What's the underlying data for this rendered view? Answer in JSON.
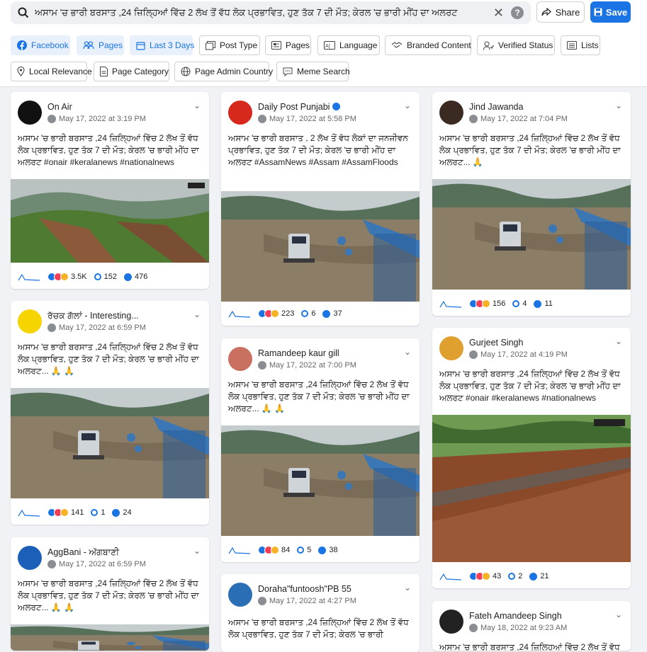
{
  "search": {
    "query": "ਅਸਾਮ 'ਚ ਭਾਰੀ ਬਰਸਾਤ ,24 ਜ਼ਿਲ੍ਹਿਆਂ ਵਿੱਚ 2 ਲੱਖ ਤੋਂ ਵੱਧ ਲੋਕ ਪ੍ਰਭਾਵਿਤ, ਹੁਣ ਤੱਕ 7 ਦੀ ਮੌਤ; ਕੇਰਲ 'ਚ ਭਾਰੀ ਮੀਂਹ ਦਾ ਅਲਰਟ",
    "help": "?"
  },
  "actions": {
    "share": "Share",
    "save": "Save"
  },
  "filters": [
    {
      "label": "Facebook",
      "icon": "facebook-icon",
      "active": true
    },
    {
      "label": "Pages",
      "icon": "people-icon",
      "active": true
    },
    {
      "label": "Last 3 Days",
      "icon": "calendar-icon",
      "active": true
    },
    {
      "label": "Post Type",
      "icon": "image-icon",
      "active": false
    },
    {
      "label": "Pages",
      "icon": "page-icon",
      "active": false
    },
    {
      "label": "Language",
      "icon": "language-icon",
      "active": false
    },
    {
      "label": "Branded Content",
      "icon": "handshake-icon",
      "active": false
    },
    {
      "label": "Verified Status",
      "icon": "verified-user-icon",
      "active": false
    },
    {
      "label": "Lists",
      "icon": "list-icon",
      "active": false
    },
    {
      "label": "Local Relevance",
      "icon": "location-icon",
      "active": false
    },
    {
      "label": "Page Category",
      "icon": "document-icon",
      "active": false
    },
    {
      "label": "Page Admin Country",
      "icon": "globe-icon",
      "active": false
    },
    {
      "label": "Meme Search",
      "icon": "chat-icon",
      "active": false
    }
  ],
  "posts": [
    {
      "name": "On Air",
      "date": "May 17, 2022 at 3:19 PM",
      "text": "ਅਸਾਮ 'ਚ ਭਾਰੀ ਬਰਸਾਤ ,24 ਜ਼ਿਲ੍ਹਿਆਂ ਵਿੱਚ 2 ਲੱਖ ਤੋਂ ਵੱਧ ਲੋਕ ਪ੍ਰਭਾਵਿਤ, ਹੁਣ ਤੱਕ 7 ਦੀ ਮੌਤ; ਕੇਰਲ 'ਚ ਭਾਰੀ ਮੀਂਹ ਦਾ ਅਲਰਟ #onair #keralanews #nationalnews",
      "reactions": "3.5K",
      "comments": "152",
      "shares": "476",
      "avatar_color": "#111111",
      "image": "landslide"
    },
    {
      "name": "ਰੱਚਕ ਗੱਲਾਂ - Interesting...",
      "date": "May 17, 2022 at 6:59 PM",
      "text": "ਅਸਾਮ 'ਚ ਭਾਰੀ ਬਰਸਾਤ ,24 ਜ਼ਿਲ੍ਹਿਆਂ ਵਿੱਚ 2 ਲੱਖ ਤੋਂ ਵੱਧ ਲੋਕ ਪ੍ਰਭਾਵਿਤ, ਹੁਣ ਤੱਕ 7 ਦੀ ਮੌਤ; ਕੇਰਲ 'ਚ ਭਾਰੀ ਮੀਂਹ ਦਾ ਅਲਰਟ... 🙏 🙏",
      "reactions": "141",
      "comments": "1",
      "shares": "24",
      "avatar_color": "#f5d400",
      "image": "flood"
    },
    {
      "name": "AggBani - ਅੱਗਬਾਣੀ",
      "date": "May 17, 2022 at 6:59 PM",
      "text": "ਅਸਾਮ 'ਚ ਭਾਰੀ ਬਰਸਾਤ ,24 ਜ਼ਿਲ੍ਹਿਆਂ ਵਿੱਚ 2 ਲੱਖ ਤੋਂ ਵੱਧ ਲੋਕ ਪ੍ਰਭਾਵਿਤ, ਹੁਣ ਤੱਕ 7 ਦੀ ਮੌਤ; ਕੇਰਲ 'ਚ ਭਾਰੀ ਮੀਂਹ ਦਾ ਅਲਰਟ... 🙏 🙏",
      "reactions": "",
      "comments": "",
      "shares": "",
      "avatar_color": "#1b5fb8",
      "image": "flood"
    },
    {
      "name": "Daily Post Punjabi",
      "verified": true,
      "date": "May 17, 2022 at 5:58 PM",
      "text": "ਅਸਾਮ 'ਚ ਭਾਰੀ ਬਰਸਾਤ , 2 ਲੱਖ ਤੋਂ ਵੱਧ ਲੋਕਾਂ ਦਾ ਜਨਜੀਵਨ ਪ੍ਰਭਾਵਿਤ, ਹੁਣ ਤੱਕ 7 ਦੀ ਮੌਤ; ਕੇਰਲ 'ਚ ਭਾਰੀ ਮੀਂਹ ਦਾ ਅਲਰਟ #AssamNews #Assam #AssamFloods",
      "reactions": "223",
      "comments": "6",
      "shares": "37",
      "avatar_color": "#d7281e",
      "image": "flood"
    },
    {
      "name": "Ramandeep kaur gill",
      "date": "May 17, 2022 at 7:00 PM",
      "text": "ਅਸਾਮ 'ਚ ਭਾਰੀ ਬਰਸਾਤ ,24 ਜ਼ਿਲ੍ਹਿਆਂ ਵਿੱਚ 2 ਲੱਖ ਤੋਂ ਵੱਧ ਲੋਕ ਪ੍ਰਭਾਵਿਤ, ਹੁਣ ਤੱਕ 7 ਦੀ ਮੌਤ; ਕੇਰਲ 'ਚ ਭਾਰੀ ਮੀਂਹ ਦਾ ਅਲਰਟ... 🙏 🙏",
      "reactions": "84",
      "comments": "5",
      "shares": "38",
      "avatar_color": "#c97060",
      "image": "flood"
    },
    {
      "name": "Dorahа\"funtoosh\"PB 55",
      "date": "May 17, 2022 at 4:27 PM",
      "text": "ਅਸਾਮ 'ਚ ਭਾਰੀ ਬਰਸਾਤ ,24 ਜ਼ਿਲ੍ਹਿਆਂ ਵਿੱਚ 2 ਲੱਖ ਤੋਂ ਵੱਧ ਲੋਕ ਪ੍ਰਭਾਵਿਤ, ਹੁਣ ਤੱਕ 7 ਦੀ ਮੌਤ; ਕੇਰਲ 'ਚ ਭਾਰੀ",
      "reactions": "",
      "comments": "",
      "shares": "",
      "avatar_color": "#2a6fb5",
      "image": "none"
    },
    {
      "name": "Jind Jawanda",
      "date": "May 17, 2022 at 7:04 PM",
      "text": "ਅਸਾਮ 'ਚ ਭਾਰੀ ਬਰਸਾਤ ,24 ਜ਼ਿਲ੍ਹਿਆਂ ਵਿੱਚ 2 ਲੱਖ ਤੋਂ ਵੱਧ ਲੋਕ ਪ੍ਰਭਾਵਿਤ, ਹੁਣ ਤੱਕ 7 ਦੀ ਮੌਤ; ਕੇਰਲ 'ਚ ਭਾਰੀ ਮੀਂਹ ਦਾ ਅਲਰਟ... 🙏",
      "reactions": "156",
      "comments": "4",
      "shares": "11",
      "avatar_color": "#3a2a22",
      "image": "flood"
    },
    {
      "name": "Gurjeet Singh",
      "date": "May 17, 2022 at 4:19 PM",
      "text": "ਅਸਾਮ 'ਚ ਭਾਰੀ ਬਰਸਾਤ ,24 ਜ਼ਿਲ੍ਹਿਆਂ ਵਿੱਚ 2 ਲੱਖ ਤੋਂ ਵੱਧ ਲੋਕ ਪ੍ਰਭਾਵਿਤ, ਹੁਣ ਤੱਕ 7 ਦੀ ਮੌਤ; ਕੇਰਲ 'ਚ ਭਾਰੀ ਮੀਂਹ ਦਾ ਅਲਰਟ #onair #keralanews #nationalnews",
      "reactions": "43",
      "comments": "2",
      "shares": "21",
      "avatar_color": "#e0a030",
      "image": "rail"
    },
    {
      "name": "Fateh Amandeep Singh",
      "date": "May 18, 2022 at 9:23 AM",
      "text": "ਅਸਾਮ 'ਚ ਭਾਰੀ ਬਰਸਾਤ ,24 ਜ਼ਿਲ੍ਹਿਆਂ ਵਿੱਚ 2 ਲੱਖ ਤੋਂ ਵੱਧ",
      "reactions": "",
      "comments": "",
      "shares": "",
      "avatar_color": "#222222",
      "image": "none"
    }
  ]
}
